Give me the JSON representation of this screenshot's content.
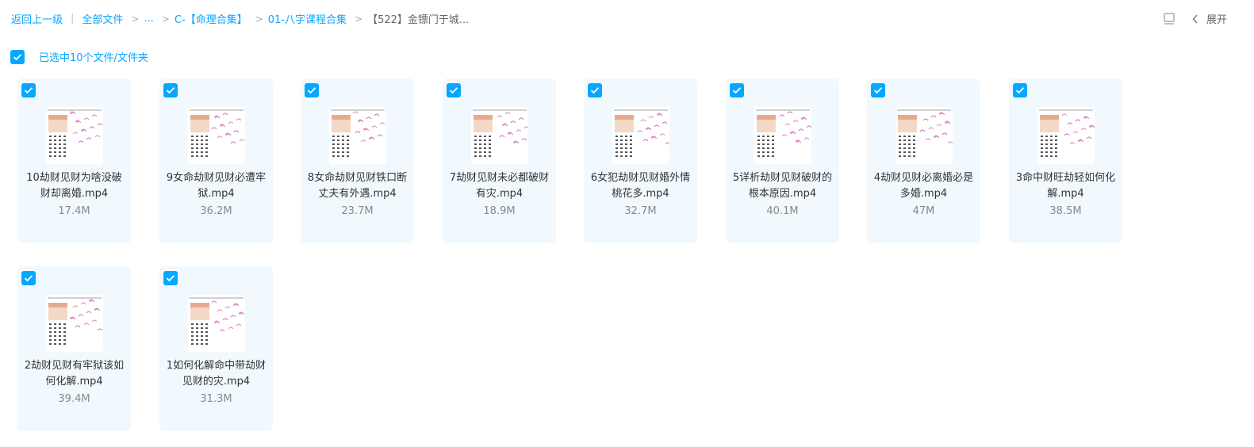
{
  "breadcrumb": {
    "back": "返回上一级",
    "all_files": "全部文件",
    "ellipsis": "...",
    "level1": "C-【命理合集】",
    "level2": "01-八字课程合集",
    "current": "【522】金镖门于城..."
  },
  "toolbar": {
    "expand_label": "展开",
    "icons": [
      "panel-icon",
      "chevron-left-icon"
    ]
  },
  "selection": {
    "checked": true,
    "text": "已选中10个文件/文件夹"
  },
  "colors": {
    "accent": "#06a7ff",
    "card_bg": "#f1f9fe"
  },
  "files": [
    {
      "name": "10劫财见财为啥没破财却离婚.mp4",
      "size": "17.4M",
      "checked": true
    },
    {
      "name": "9女命劫财见财必遭牢狱.mp4",
      "size": "36.2M",
      "checked": true
    },
    {
      "name": "8女命劫财见财铁口断丈夫有外遇.mp4",
      "size": "23.7M",
      "checked": true
    },
    {
      "name": "7劫财见财未必都破财有灾.mp4",
      "size": "18.9M",
      "checked": true
    },
    {
      "name": "6女犯劫财见财婚外情桃花多.mp4",
      "size": "32.7M",
      "checked": true
    },
    {
      "name": "5详析劫财见财破财的根本原因.mp4",
      "size": "40.1M",
      "checked": true
    },
    {
      "name": "4劫财见财必离婚必是多婚.mp4",
      "size": "47M",
      "checked": true
    },
    {
      "name": "3命中财旺劫轻如何化解.mp4",
      "size": "38.5M",
      "checked": true
    },
    {
      "name": "2劫财见财有牢狱该如何化解.mp4",
      "size": "39.4M",
      "checked": true
    },
    {
      "name": "1如何化解命中带劫财见财的灾.mp4",
      "size": "31.3M",
      "checked": true
    }
  ]
}
